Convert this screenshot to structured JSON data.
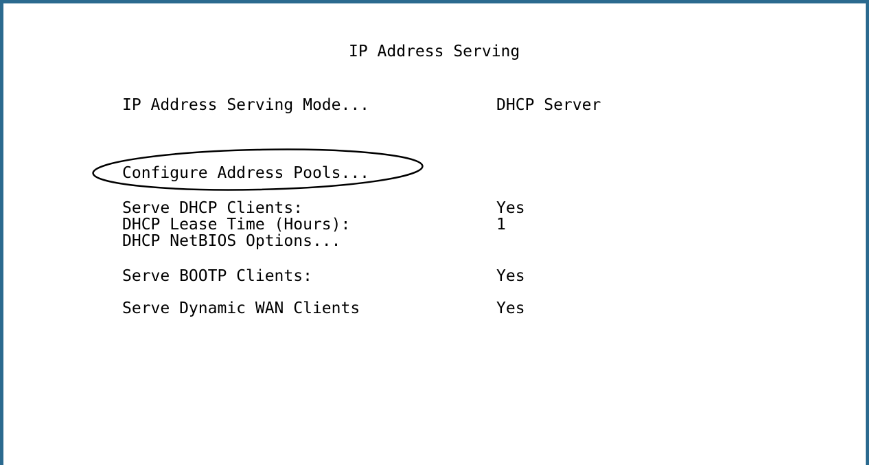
{
  "screen": {
    "title": "IP Address Serving",
    "serving_mode": {
      "label": "IP Address Serving Mode...",
      "value": "DHCP Server"
    },
    "configure_pools": {
      "label": "Configure Address Pools..."
    },
    "serve_dhcp": {
      "label": "Serve DHCP Clients:",
      "value": "Yes"
    },
    "lease_time": {
      "label": "DHCP Lease Time (Hours):",
      "value": "1"
    },
    "netbios": {
      "label": "DHCP NetBIOS Options..."
    },
    "serve_bootp": {
      "label": "Serve BOOTP Clients:",
      "value": "Yes"
    },
    "serve_dynamic_wan": {
      "label": "Serve Dynamic WAN Clients",
      "value": "Yes"
    }
  },
  "colors": {
    "frame_border": "#2b6a8f",
    "background": "#ffffff",
    "text": "#000000"
  }
}
